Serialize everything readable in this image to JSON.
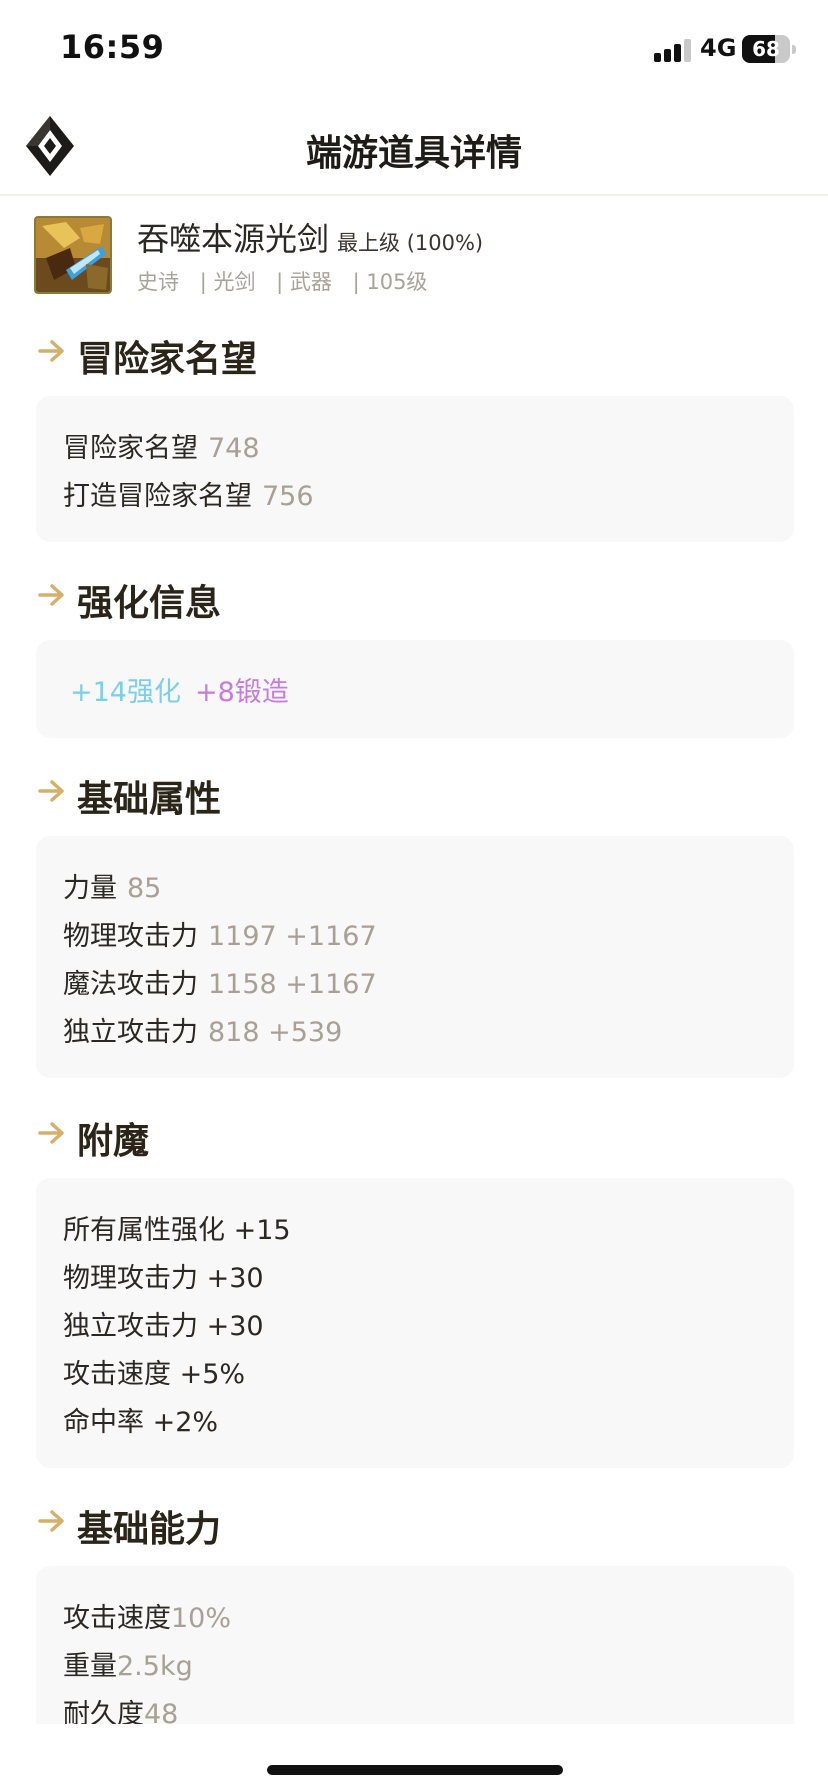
{
  "status_bar": {
    "time": "16:59",
    "network": "4G",
    "battery": "68",
    "battery_level": 0.68
  },
  "nav": {
    "title": "端游道具详情"
  },
  "item": {
    "name": "吞噬本源光剑",
    "grade": "最上级 (100%)",
    "tags": [
      "史诗",
      "| 光剑",
      "| 武器",
      "| 105级"
    ]
  },
  "sections": {
    "renown": {
      "title": "冒险家名望",
      "rows": [
        {
          "label": "冒险家名望",
          "value": "748"
        },
        {
          "label": "打造冒险家名望",
          "value": "756"
        }
      ]
    },
    "enhance": {
      "title": "强化信息",
      "reinforce": "+14强化",
      "amplify": "+8锻造"
    },
    "base_stats": {
      "title": "基础属性",
      "rows": [
        {
          "label": "力量",
          "value": "85"
        },
        {
          "label": "物理攻击力",
          "value": "1197 +1167"
        },
        {
          "label": "魔法攻击力",
          "value": "1158 +1167"
        },
        {
          "label": "独立攻击力",
          "value": "818 +539"
        }
      ]
    },
    "enchant": {
      "title": "附魔",
      "rows": [
        "所有属性强化 +15",
        "物理攻击力 +30",
        "独立攻击力 +30",
        "攻击速度 +5%",
        "命中率 +2%"
      ]
    },
    "base_ability": {
      "title": "基础能力",
      "rows": [
        {
          "label": "攻击速度",
          "value": "10%"
        },
        {
          "label": "重量",
          "value": "2.5kg"
        },
        {
          "label": "耐久度",
          "value": "48"
        }
      ]
    }
  },
  "colors": {
    "accent_gold": "#d4b06a",
    "value_gray": "#a8a093",
    "reinforce": "#7ccfe8",
    "amplify": "#c77be0",
    "card_bg": "#f8f8f8"
  },
  "icons": [
    "signal-icon",
    "battery-icon",
    "app-logo-icon",
    "item-icon",
    "section-arrow-icon"
  ]
}
